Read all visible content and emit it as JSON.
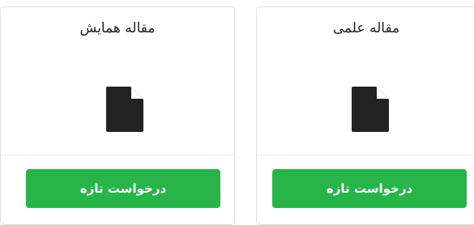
{
  "cards": [
    {
      "title": "مقاله همایش",
      "icon": "document-icon",
      "button_label": "درخواست تازه"
    },
    {
      "title": "مقاله علمی",
      "icon": "document-icon",
      "button_label": "درخواست تازه"
    }
  ],
  "colors": {
    "button_bg": "#27b54a",
    "icon": "#222222",
    "card_border": "#dfe1e5"
  }
}
